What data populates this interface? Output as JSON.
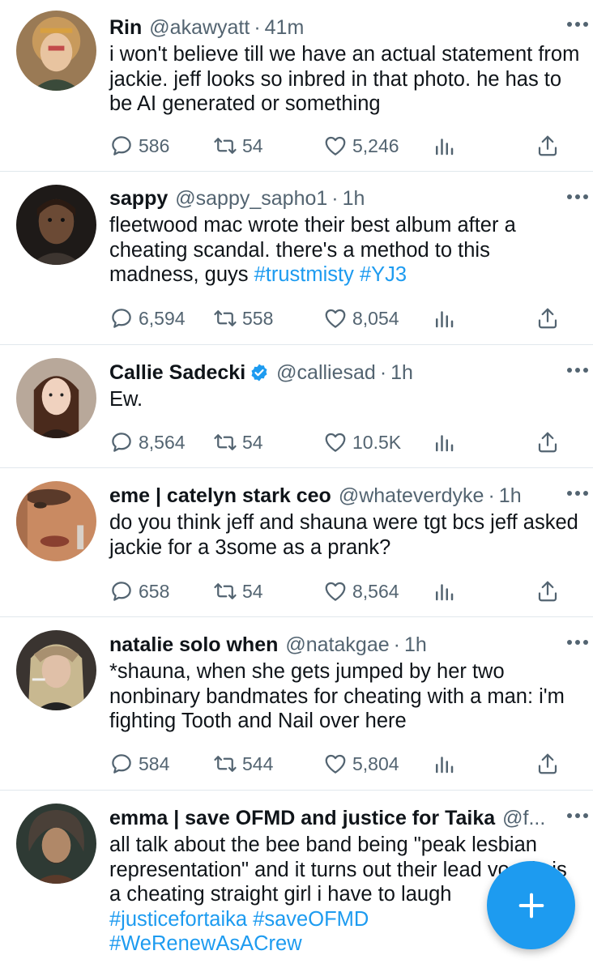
{
  "tweets": [
    {
      "name": "Rin",
      "handle": "@akawyatt",
      "time": "41m",
      "verified": false,
      "text_parts": [
        {
          "t": "i won't believe till we have an actual statement from jackie. jeff looks so inbred in that photo. he has to be AI generated or something",
          "tag": false
        }
      ],
      "replies": "586",
      "retweets": "54",
      "likes": "5,246"
    },
    {
      "name": "sappy",
      "handle": "@sappy_sapho1",
      "time": "1h",
      "verified": false,
      "text_parts": [
        {
          "t": "fleetwood mac wrote their best album after a cheating scandal. there's a method to this madness, guys ",
          "tag": false
        },
        {
          "t": "#trustmisty",
          "tag": true
        },
        {
          "t": " ",
          "tag": false
        },
        {
          "t": "#YJ3",
          "tag": true
        }
      ],
      "replies": "6,594",
      "retweets": "558",
      "likes": "8,054"
    },
    {
      "name": "Callie Sadecki",
      "handle": "@calliesad",
      "time": "1h",
      "verified": true,
      "text_parts": [
        {
          "t": "Ew.",
          "tag": false
        }
      ],
      "replies": "8,564",
      "retweets": "54",
      "likes": "10.5K"
    },
    {
      "name": "eme | catelyn stark ceo",
      "handle": "@whateverdyke",
      "time": "1h",
      "verified": false,
      "text_parts": [
        {
          "t": "do you think jeff and shauna were tgt bcs jeff asked jackie for a 3some as a prank?",
          "tag": false
        }
      ],
      "replies": "658",
      "retweets": "54",
      "likes": "8,564"
    },
    {
      "name": "natalie solo when",
      "handle": "@natakgae",
      "time": "1h",
      "verified": false,
      "text_parts": [
        {
          "t": "*shauna, when she gets jumped by her two nonbinary bandmates for cheating with a man: i'm fighting Tooth and Nail over here",
          "tag": false
        }
      ],
      "replies": "584",
      "retweets": "544",
      "likes": "5,804"
    },
    {
      "name": "emma | save OFMD and justice for Taika",
      "handle": "@f...",
      "time": "",
      "verified": false,
      "text_parts": [
        {
          "t": "all talk about the bee band being \"peak lesbian representation\" and it turns out their lead vocals is a cheating straight girl i have to laugh",
          "tag": false
        },
        {
          "t": "\n",
          "tag": false
        },
        {
          "t": "#justicefortaika",
          "tag": true
        },
        {
          "t": " ",
          "tag": false
        },
        {
          "t": "#saveOFMD",
          "tag": true
        },
        {
          "t": "\n",
          "tag": false
        },
        {
          "t": "#WeRenewAsACrew",
          "tag": true
        }
      ],
      "replies": "",
      "retweets": "",
      "likes": ""
    }
  ],
  "icons": {
    "reply": "reply-icon",
    "retweet": "retweet-icon",
    "like": "heart-icon",
    "views": "views-icon",
    "share": "share-icon",
    "more": "more-icon",
    "compose": "compose-plus-icon",
    "verified": "verified-badge-icon"
  },
  "colors": {
    "accent": "#1d9bf0",
    "secondary_text": "#536471",
    "divider": "#e1e8ed"
  }
}
